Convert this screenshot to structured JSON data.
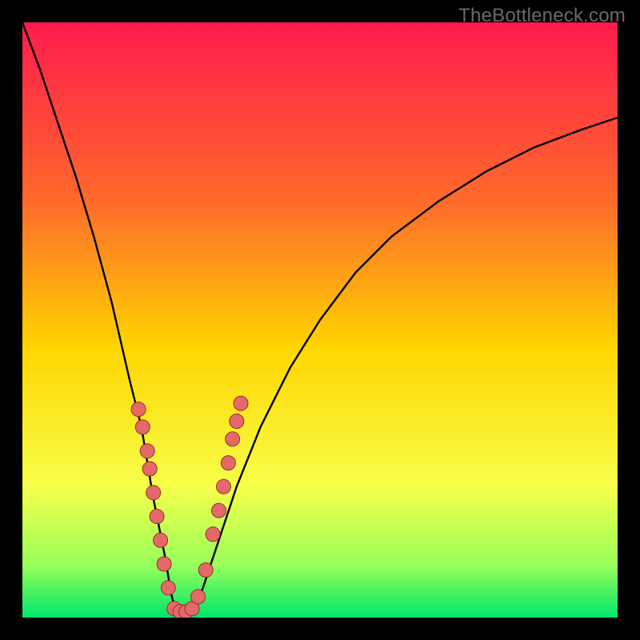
{
  "watermark": "TheBottleneck.com",
  "colors": {
    "frame": "#000000",
    "grad_top": "#ff1a4e",
    "grad_mid1": "#ff6a2a",
    "grad_mid2": "#ffd600",
    "grad_mid3": "#f6ff4a",
    "grad_low1": "#9aff5a",
    "grad_low2": "#00e66a",
    "curve": "#000000",
    "marker_fill": "#e46a6a",
    "marker_stroke": "#9c2b2b"
  },
  "chart_data": {
    "type": "line",
    "title": "",
    "xlabel": "",
    "ylabel": "",
    "xlim": [
      0,
      100
    ],
    "ylim": [
      0,
      100
    ],
    "series": [
      {
        "name": "bottleneck-curve",
        "x": [
          0,
          3,
          6,
          9,
          12,
          15,
          18,
          20,
          22,
          24,
          25,
          26,
          27,
          28,
          30,
          33,
          36,
          40,
          45,
          50,
          56,
          62,
          70,
          78,
          86,
          94,
          100
        ],
        "y": [
          100,
          92,
          83,
          74,
          64,
          53,
          40,
          32,
          20,
          10,
          4,
          0,
          0,
          0,
          4,
          13,
          22,
          32,
          42,
          50,
          58,
          64,
          70,
          75,
          79,
          82,
          84
        ]
      }
    ],
    "markers": {
      "name": "highlighted-points",
      "x": [
        19.5,
        20.2,
        21.0,
        21.4,
        22.0,
        22.6,
        23.2,
        23.8,
        24.5,
        25.5,
        26.5,
        27.5,
        28.5,
        29.5,
        30.8,
        32.0,
        33.0,
        33.8,
        34.6,
        35.3,
        36.0,
        36.7
      ],
      "y": [
        35.0,
        32.0,
        28.0,
        25.0,
        21.0,
        17.0,
        13.0,
        9.0,
        5.0,
        1.5,
        1.0,
        1.0,
        1.5,
        3.5,
        8.0,
        14.0,
        18.0,
        22.0,
        26.0,
        30.0,
        33.0,
        36.0
      ]
    }
  }
}
